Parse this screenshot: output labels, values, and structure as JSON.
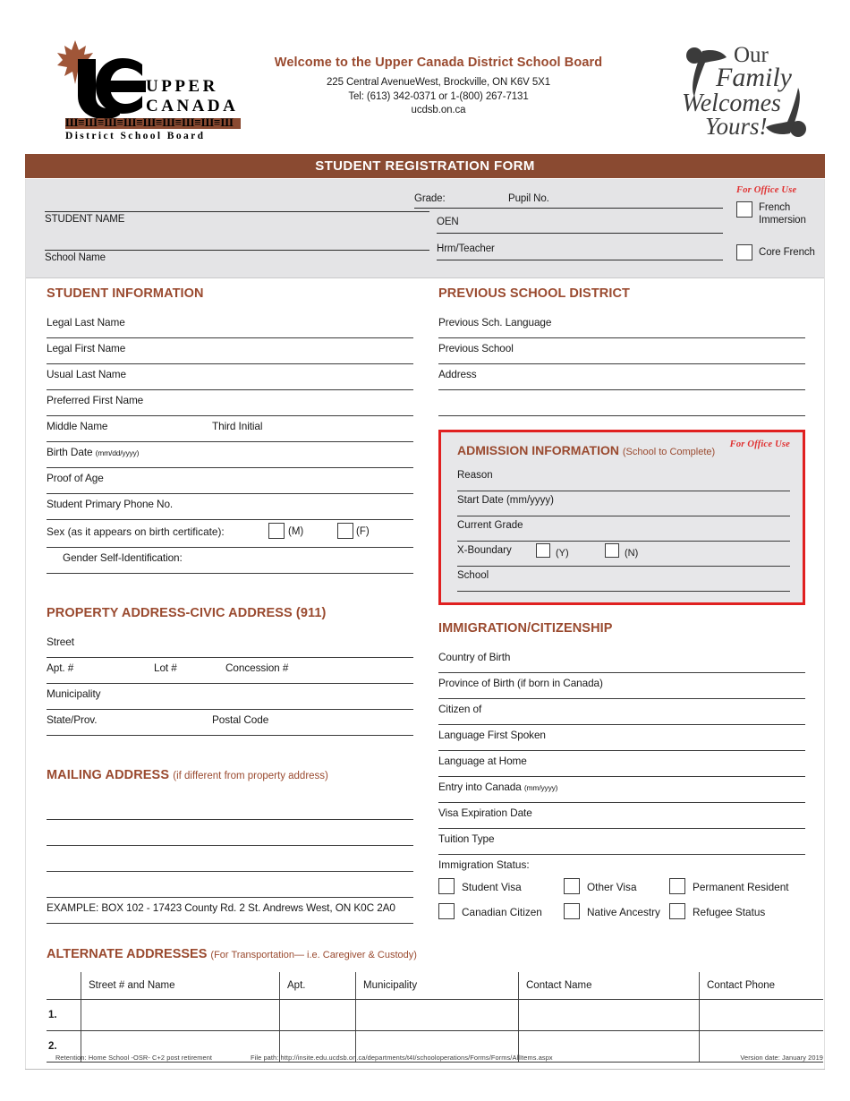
{
  "header": {
    "logo_left": {
      "word1": "UPPER",
      "word2": "CANADA",
      "bar_glyphs": "Ш≡Ш≡Ш≡Ш≡Ш≡Ш≡Ш≡Ш≡Ш",
      "sub": "District School Board"
    },
    "welcome_title": "Welcome to the Upper Canada District School Board",
    "address": "225 Central AvenueWest, Brockville, ON K6V 5X1",
    "phone": "Tel: (613) 342-0371 or 1-(800) 267-7131",
    "website": "ucdsb.on.ca",
    "logo_right": {
      "line1": "Our",
      "line2": "Family",
      "line3": "Welcomes",
      "line4": "Yours!"
    }
  },
  "title_bar": {
    "title": "STUDENT REGISTRATION FORM"
  },
  "top_band": {
    "student_name_label": "STUDENT NAME",
    "school_name_label": "School Name",
    "grade_label": "Grade:",
    "pupil_no_label": "Pupil No.",
    "oen_label": "OEN",
    "hrm_teacher_label": "Hrm/Teacher",
    "office_use_label": "For Office Use",
    "french_immersion_label_1": "French",
    "french_immersion_label_2": "Immersion",
    "core_french_label": "Core French"
  },
  "student_information": {
    "heading": "STUDENT INFORMATION",
    "fields": [
      {
        "label": "Legal Last Name"
      },
      {
        "label": "Legal First Name"
      },
      {
        "label": "Usual Last Name"
      },
      {
        "label": "Preferred First Name"
      },
      {
        "label": "Middle Name",
        "label2": "Third Initial"
      },
      {
        "label": "Birth Date",
        "hint": "(mm/dd/yyyy)"
      },
      {
        "label": "Proof of Age"
      },
      {
        "label": "Student Primary Phone No."
      }
    ],
    "sex_label": "Sex (as it appears on birth certificate):",
    "sex_option_m": "(M)",
    "sex_option_f": "(F)",
    "gender_self_id_label": "Gender Self-Identification:"
  },
  "property_address": {
    "heading": "PROPERTY ADDRESS-CIVIC ADDRESS (911)",
    "fields": [
      {
        "label": "Street"
      },
      {
        "label": "Apt. #",
        "label2": "Lot #",
        "label3": "Concession #"
      },
      {
        "label": "Municipality"
      },
      {
        "label": "State/Prov.",
        "label2": "Postal Code"
      }
    ]
  },
  "mailing_address": {
    "heading": "MAILING ADDRESS",
    "heading_sub": "(if different from property address)",
    "blank_lines": 4,
    "example": "EXAMPLE: BOX 102 - 17423 County Rd. 2 St. Andrews West, ON K0C 2A0"
  },
  "previous_school": {
    "heading": "PREVIOUS SCHOOL DISTRICT",
    "fields": [
      {
        "label": "Previous Sch. Language"
      },
      {
        "label": "Previous School"
      },
      {
        "label": "Address"
      },
      {
        "label": ""
      }
    ]
  },
  "admission_information": {
    "heading": "ADMISSION INFORMATION",
    "heading_sub": "(School to Complete)",
    "office_use_label": "For Office Use",
    "fields": [
      {
        "label": "Reason"
      },
      {
        "label": "Start Date (mm/yyyy)"
      },
      {
        "label": "Current Grade"
      }
    ],
    "xboundary_label": "X-Boundary",
    "xboundary_yes": "(Y)",
    "xboundary_no": "(N)",
    "school_label": "School"
  },
  "immigration": {
    "heading": "IMMIGRATION/CITIZENSHIP",
    "fields": [
      {
        "label": "Country of Birth"
      },
      {
        "label": "Province of Birth (if born in Canada)"
      },
      {
        "label": "Citizen of"
      },
      {
        "label": "Language First Spoken"
      },
      {
        "label": "Language at Home"
      },
      {
        "label": "Entry into Canada",
        "hint": "(mm/yyyy)"
      },
      {
        "label": "Visa Expiration Date"
      },
      {
        "label": "Tuition Type"
      }
    ],
    "status_label": "Immigration Status:",
    "status_options": [
      "Student Visa",
      "Other Visa",
      "Permanent Resident",
      "Canadian Citizen",
      "Native Ancestry",
      "Refugee Status"
    ]
  },
  "alternate_addresses": {
    "heading": "ALTERNATE ADDRESSES",
    "heading_sub": "(For Transportation— i.e. Caregiver & Custody)",
    "columns": [
      "Street # and Name",
      "Apt.",
      "Municipality",
      "Contact Name",
      "Contact Phone"
    ],
    "rows": [
      {
        "num": "1.",
        "street": "",
        "apt": "",
        "municipality": "",
        "contact_name": "",
        "contact_phone": ""
      },
      {
        "num": "2.",
        "street": "",
        "apt": "",
        "municipality": "",
        "contact_name": "",
        "contact_phone": ""
      }
    ]
  },
  "footer": {
    "retention": "Retention: Home School -OSR- C+2 post retirement",
    "file_path": "File path: http://insite.edu.ucdsb.on.ca/departments/t4I/schooloperations/Forms/Forms/AllItems.aspx",
    "version": "Version date: January 2019"
  },
  "colors": {
    "brand_brown": "#8a4a31",
    "heading_brown": "#9a4a2f",
    "office_red": "#e02020",
    "band_grey": "#e4e4e6"
  }
}
